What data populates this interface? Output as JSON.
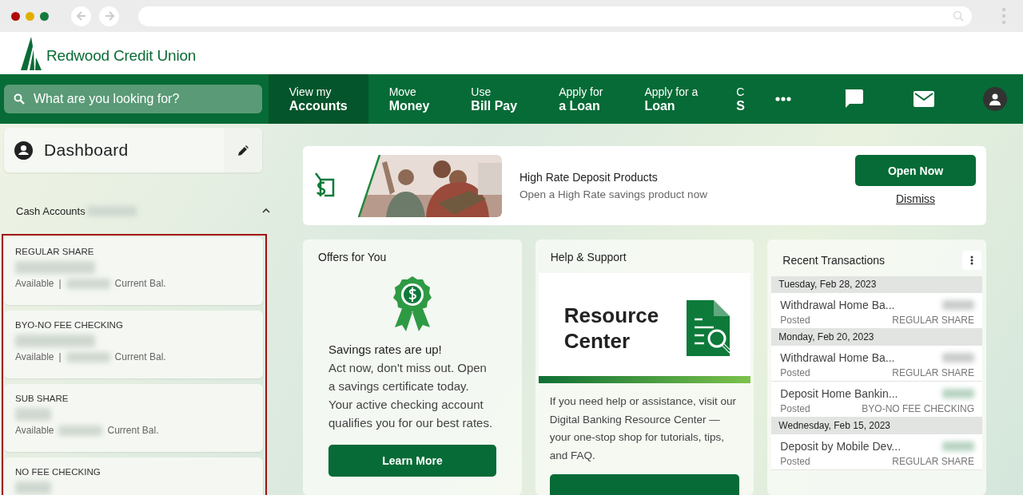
{
  "brand": {
    "name": "Redwood Credit Union"
  },
  "search": {
    "placeholder": "What are you looking for?"
  },
  "nav": [
    {
      "line1": "View my",
      "line2": "Accounts",
      "selected": true
    },
    {
      "line1": "Move",
      "line2": "Money",
      "selected": false
    },
    {
      "line1": "Use",
      "line2": "Bill Pay",
      "selected": false
    },
    {
      "line1": "Apply for",
      "line2": "a Loan",
      "selected": false
    },
    {
      "line1": "Apply for a",
      "line2": "Loan",
      "selected": false
    },
    {
      "line1": "C",
      "line2": "S",
      "selected": false
    }
  ],
  "sidebar": {
    "title": "Dashboard",
    "section": {
      "label": "Cash Accounts",
      "expanded": true
    },
    "accounts": [
      {
        "name": "REGULAR SHARE",
        "available": "Available",
        "separator": "|",
        "current": "Current Bal."
      },
      {
        "name": "BYO-NO FEE CHECKING",
        "available": "Available",
        "separator": "|",
        "current": "Current Bal."
      },
      {
        "name": "SUB SHARE",
        "available": "Available",
        "current": "Current Bal."
      },
      {
        "name": "NO FEE CHECKING"
      }
    ]
  },
  "banner": {
    "title": "High Rate Deposit Products",
    "subtitle": "Open a High Rate savings product now",
    "primary": "Open Now",
    "secondary": "Dismiss"
  },
  "offers": {
    "title": "Offers for You",
    "headline": "Savings rates are up!",
    "body": "Act now, don't miss out. Open a savings certificate today. Your active checking account qualifies you for our best rates.",
    "button": "Learn More"
  },
  "help": {
    "title": "Help & Support",
    "graphic_title": "Resource Center",
    "body": "If you need help or assistance, visit our Digital Banking Resource Center — your one-stop shop for tutorials, tips, and FAQ."
  },
  "transactions": {
    "title": "Recent Transactions",
    "groups": [
      {
        "date": "Tuesday, Feb 28, 2023",
        "items": [
          {
            "description": "Withdrawal Home Ba...",
            "status": "Posted",
            "account": "REGULAR SHARE",
            "kind": "debit"
          }
        ]
      },
      {
        "date": "Monday, Feb 20, 2023",
        "items": [
          {
            "description": "Withdrawal Home Ba...",
            "status": "Posted",
            "account": "REGULAR SHARE",
            "kind": "debit"
          },
          {
            "description": "Deposit Home Bankin...",
            "status": "Posted",
            "account": "BYO-NO FEE CHECKING",
            "kind": "credit"
          }
        ]
      },
      {
        "date": "Wednesday, Feb 15, 2023",
        "items": [
          {
            "description": "Deposit by Mobile Dev...",
            "status": "Posted",
            "account": "REGULAR SHARE",
            "kind": "credit"
          }
        ]
      }
    ]
  }
}
